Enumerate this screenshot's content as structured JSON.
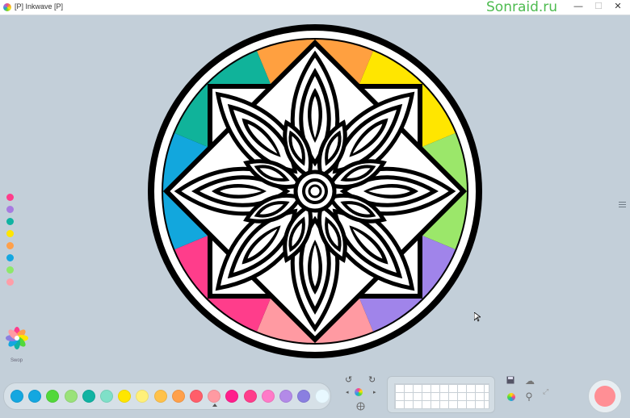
{
  "window": {
    "title": "[P] Inkwave [P]",
    "watermark": "Sonraid.ru",
    "minimize": "—",
    "maximize": "☐",
    "close": "✕"
  },
  "left_panel": {
    "colors": [
      "#ff3d8b",
      "#a77be0",
      "#10b3a2",
      "#ffe600",
      "#ffa04a",
      "#14a7e0",
      "#8ee86a",
      "#ff9ea8"
    ],
    "palette_label": "Swop"
  },
  "mandala": {
    "ring_colors": [
      "#ffa040",
      "#ffe600",
      "#9be76a",
      "#a084ea",
      "#ff9aa2",
      "#ff3d8b",
      "#12a7dd",
      "#10b39a"
    ]
  },
  "toolbar": {
    "swatches": [
      "#14a7e0",
      "#14a7e0",
      "#52d83a",
      "#9ae27a",
      "#10b3a2",
      "#7fe0c8",
      "#ffe600",
      "#fff07a",
      "#ffc24a",
      "#ffa04a",
      "#ff5e6a",
      "#ff9aa2",
      "#ff1e8c",
      "#ff3d8b",
      "#ff7ac8",
      "#b38ae8",
      "#8a7fe0",
      "#e8f8ff"
    ],
    "undo": "↺",
    "redo": "↻",
    "prev": "◂",
    "next": "▸",
    "save": "💾",
    "cloud": "☁",
    "expand": "⤢",
    "current_color": "#ff8f95"
  }
}
